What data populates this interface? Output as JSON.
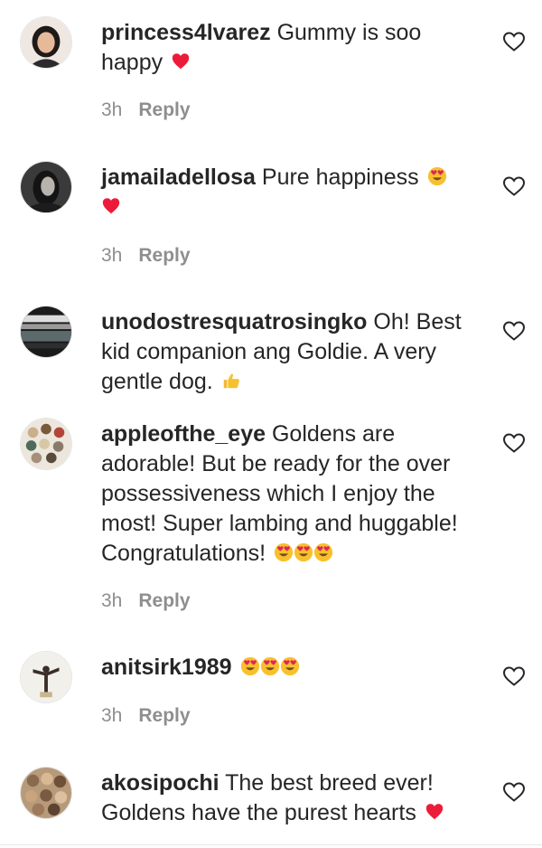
{
  "comments": [
    {
      "username": "princess4lvarez",
      "text": "Gummy is soo happy",
      "emojis": [
        "red-heart"
      ],
      "time": "3h",
      "reply_label": "Reply"
    },
    {
      "username": "jamailadellosa",
      "text": "Pure happiness",
      "emojis": [
        "smiling-face-with-heart-eyes",
        "red-heart"
      ],
      "time": "3h",
      "reply_label": "Reply"
    },
    {
      "username": "unodostresquatrosingko",
      "text": "Oh! Best kid companion ang Goldie. A very gentle dog.",
      "emojis": [
        "thumbs-up"
      ]
    },
    {
      "username": "appleofthe_eye",
      "text": "Goldens are adorable! But be ready for the over possessiveness which I enjoy the most! Super lambing and huggable! Congratulations!",
      "emojis": [
        "smiling-face-with-heart-eyes",
        "smiling-face-with-heart-eyes",
        "smiling-face-with-heart-eyes"
      ],
      "time": "3h",
      "reply_label": "Reply"
    },
    {
      "username": "anitsirk1989",
      "text": "",
      "emojis": [
        "smiling-face-with-heart-eyes",
        "smiling-face-with-heart-eyes",
        "smiling-face-with-heart-eyes"
      ],
      "time": "3h",
      "reply_label": "Reply"
    },
    {
      "username": "akosipochi",
      "text": "The best breed ever! Goldens have the purest hearts",
      "emojis": [
        "red-heart"
      ]
    }
  ],
  "icons": {
    "like": "heart-outline-icon"
  },
  "colors": {
    "text": "#262626",
    "meta": "#8e8e8e",
    "heart": "#ed1b3a",
    "emoji_face": "#f7c12e",
    "thumb": "#f5b63b"
  }
}
